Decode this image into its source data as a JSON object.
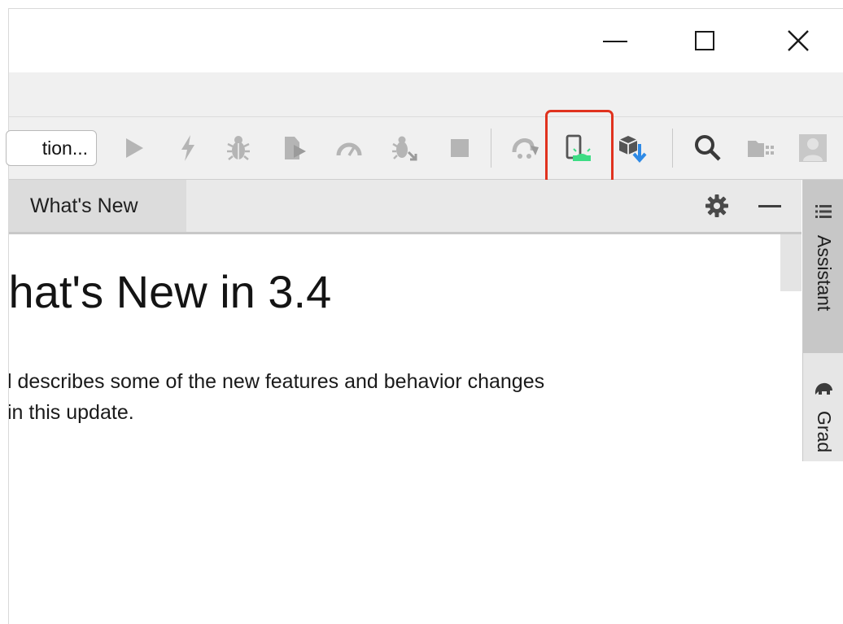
{
  "window_controls": {
    "minimize": "minimize-icon",
    "maximize": "maximize-icon",
    "close": "close-icon"
  },
  "toolbar": {
    "run_config_label": "tion...",
    "icons": [
      "run-icon",
      "apply-changes-icon",
      "debug-icon",
      "run-with-coverage-icon",
      "profile-icon",
      "attach-debugger-icon",
      "stop-icon",
      "sync-project-icon",
      "avd-manager-icon",
      "sdk-manager-icon",
      "search-icon",
      "project-structure-icon",
      "user-icon"
    ],
    "highlight_color": "#e0321e",
    "highlighted_icon": "avd-manager-icon"
  },
  "tool_window": {
    "tab_label": "What's New",
    "actions": [
      "gear-icon",
      "hide-icon"
    ]
  },
  "side_panel": {
    "tabs": [
      {
        "label": "Assistant",
        "icon": "list-icon"
      },
      {
        "label": "Grad",
        "icon": "elephant-icon"
      }
    ]
  },
  "content": {
    "title": "/hat's New in 3.4",
    "body_line1": "l describes some of the new features and behavior changes",
    "body_line2": "in this update."
  },
  "colors": {
    "android_green": "#3ddc84",
    "sdk_blue": "#2e8ae6",
    "disabled_gray": "#b5b5b5"
  }
}
